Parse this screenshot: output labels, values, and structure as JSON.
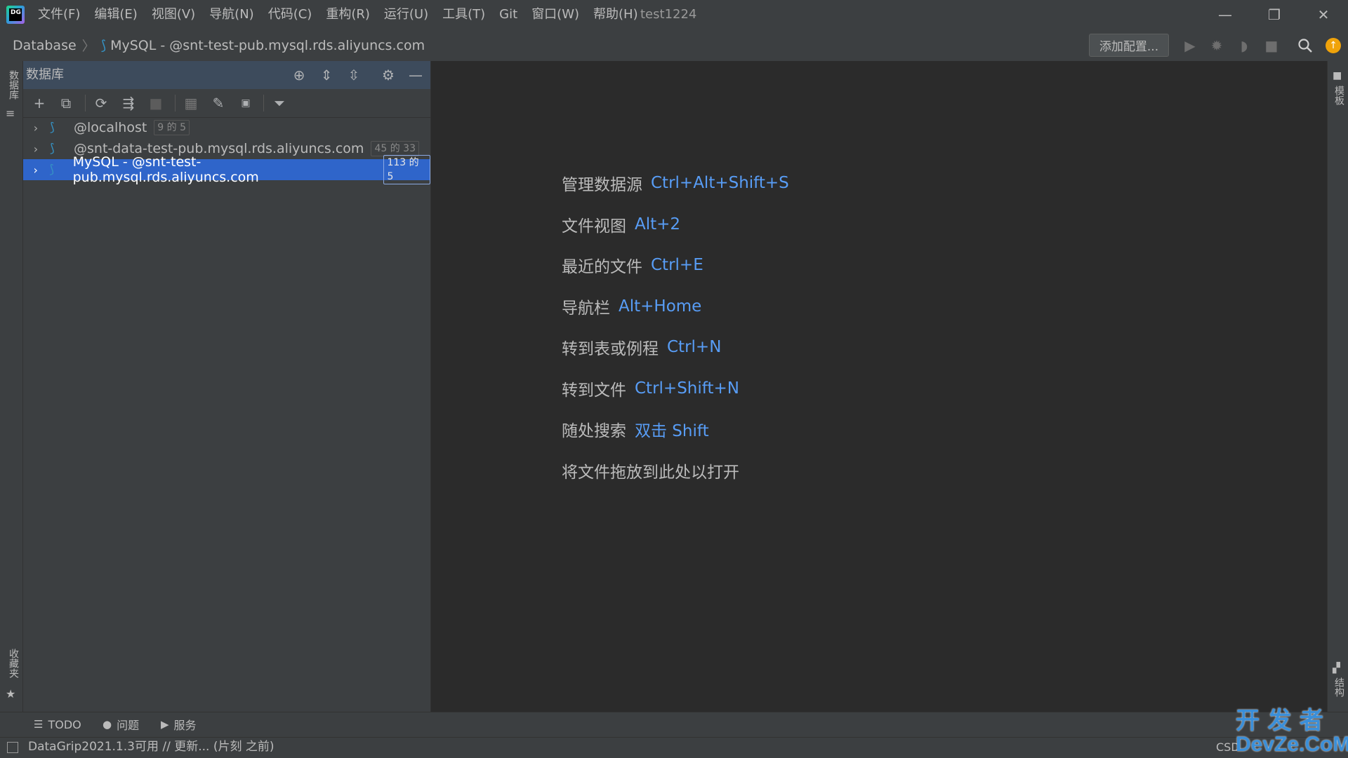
{
  "window": {
    "app_logo_text": "DG",
    "project_title": "test1224",
    "menu": [
      "文件(F)",
      "编辑(E)",
      "视图(V)",
      "导航(N)",
      "代码(C)",
      "重构(R)",
      "运行(U)",
      "工具(T)",
      "Git",
      "窗口(W)",
      "帮助(H)"
    ],
    "controls": {
      "minimize": "—",
      "restore": "❐",
      "close": "✕"
    }
  },
  "navbar": {
    "breadcrumb": [
      "Database",
      "MySQL - @snt-test-pub.mysql.rds.aliyuncs.com"
    ],
    "add_config_label": "添加配置...",
    "icons": [
      "run-icon",
      "debug-icon",
      "coverage-icon",
      "stop-icon",
      "search-icon",
      "update-icon"
    ]
  },
  "left_stripe": {
    "database_tab": "数据库",
    "favorites_tab": "收藏夹"
  },
  "right_stripe": {
    "top_tab": "模板",
    "bottom_tab": "结构"
  },
  "db_panel": {
    "title": "数据库",
    "tree": [
      {
        "name": "@localhost",
        "badge": "9 的 5",
        "selected": false
      },
      {
        "name": "@snt-data-test-pub.mysql.rds.aliyuncs.com",
        "badge": "45 的 33",
        "selected": false
      },
      {
        "name": "MySQL - @snt-test-pub.mysql.rds.aliyuncs.com",
        "badge": "113 的 5",
        "selected": true
      }
    ]
  },
  "editor": {
    "hints": [
      {
        "label": "管理数据源",
        "keys": "Ctrl+Alt+Shift+S"
      },
      {
        "label": "文件视图",
        "keys": "Alt+2"
      },
      {
        "label": "最近的文件",
        "keys": "Ctrl+E"
      },
      {
        "label": "导航栏",
        "keys": "Alt+Home"
      },
      {
        "label": "转到表或例程",
        "keys": "Ctrl+N"
      },
      {
        "label": "转到文件",
        "keys": "Ctrl+Shift+N"
      },
      {
        "label": "随处搜索",
        "keys": "双击 Shift"
      },
      {
        "label": "将文件拖放到此处以打开",
        "keys": ""
      }
    ]
  },
  "bottom": {
    "tabs": [
      "TODO",
      "问题",
      "服务"
    ],
    "status_text": "DataGrip2021.1.3可用 // 更新... (片刻 之前)",
    "csdn_text": "CSD",
    "watermark_line1": "开 发 者",
    "watermark_line2": "DevZe.CoM"
  },
  "colors": {
    "accent_blue": "#589df6",
    "selection": "#2f65ca",
    "panel_header": "#3d4b5c",
    "background": "#2b2b2b"
  }
}
